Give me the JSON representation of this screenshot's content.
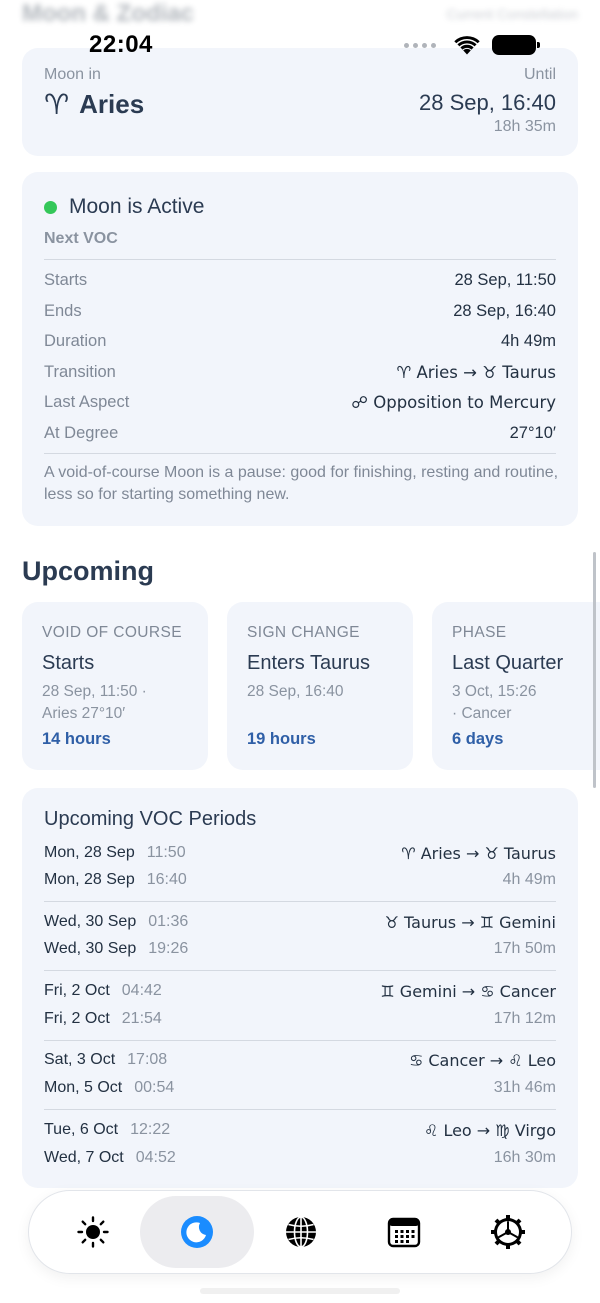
{
  "header": {
    "title": "Moon & Zodiac",
    "subtitle": "Current Constellation"
  },
  "status_bar": {
    "time": "22:04"
  },
  "moon_card": {
    "label": "Moon in",
    "sign_glyph": "♈",
    "sign": "Aries",
    "until_label": "Until",
    "until_date": "28 Sep, 16:40",
    "time_left": "18h 35m"
  },
  "active_card": {
    "status": "Moon is Active",
    "status_color": "#34c759",
    "subtitle": "Next VOC",
    "rows": [
      {
        "key": "Starts",
        "value": "28 Sep, 11:50"
      },
      {
        "key": "Ends",
        "value": "28 Sep, 16:40"
      },
      {
        "key": "Duration",
        "value": "4h 49m"
      },
      {
        "key": "Transition",
        "value": "♈ Aries → ♉ Taurus"
      },
      {
        "key": "Last Aspect",
        "value": "☍ Opposition to Mercury"
      },
      {
        "key": "At Degree",
        "value": "27°10′"
      }
    ],
    "note": "A void-of-course Moon is a pause: good for finishing, resting and routine, less so for starting something new."
  },
  "upcoming": {
    "title": "Upcoming",
    "cards": [
      {
        "type": "VOID OF COURSE",
        "title": "Starts",
        "detail1": "28 Sep, 11:50 ·",
        "detail2": "Aries 27°10′",
        "time": "14 hours"
      },
      {
        "type": "SIGN CHANGE",
        "title": "Enters Taurus",
        "detail1": "28 Sep, 16:40",
        "detail2": "",
        "time": "19 hours"
      },
      {
        "type": "PHASE",
        "title": "Last Quarter",
        "detail1": "3 Oct, 15:26",
        "detail2": "· Cancer",
        "time": "6 days"
      }
    ]
  },
  "voc_periods": {
    "title": "Upcoming VOC Periods",
    "items": [
      {
        "start_day": "Mon, 28 Sep",
        "start_time": "11:50",
        "end_day": "Mon, 28 Sep",
        "end_time": "16:40",
        "transition": "♈ Aries → ♉ Taurus",
        "duration": "4h 49m"
      },
      {
        "start_day": "Wed, 30 Sep",
        "start_time": "01:36",
        "end_day": "Wed, 30 Sep",
        "end_time": "19:26",
        "transition": "♉ Taurus → ♊ Gemini",
        "duration": "17h 50m"
      },
      {
        "start_day": "Fri, 2 Oct",
        "start_time": "04:42",
        "end_day": "Fri, 2 Oct",
        "end_time": "21:54",
        "transition": "♊ Gemini → ♋ Cancer",
        "duration": "17h 12m"
      },
      {
        "start_day": "Sat, 3 Oct",
        "start_time": "17:08",
        "end_day": "Mon, 5 Oct",
        "end_time": "00:54",
        "transition": "♋ Cancer → ♌ Leo",
        "duration": "31h 46m"
      },
      {
        "start_day": "Tue, 6 Oct",
        "start_time": "12:22",
        "end_day": "Wed, 7 Oct",
        "end_time": "04:52",
        "transition": "♌ Leo → ♍ Virgo",
        "duration": "16h 30m"
      }
    ]
  },
  "tabbar": {
    "items": [
      {
        "icon": "sun-icon",
        "active": false
      },
      {
        "icon": "moon-icon",
        "active": true
      },
      {
        "icon": "globe-icon",
        "active": false
      },
      {
        "icon": "calendar-icon",
        "active": false
      },
      {
        "icon": "settings-gear-icon",
        "active": false
      }
    ],
    "accent": "#1a8cff"
  }
}
